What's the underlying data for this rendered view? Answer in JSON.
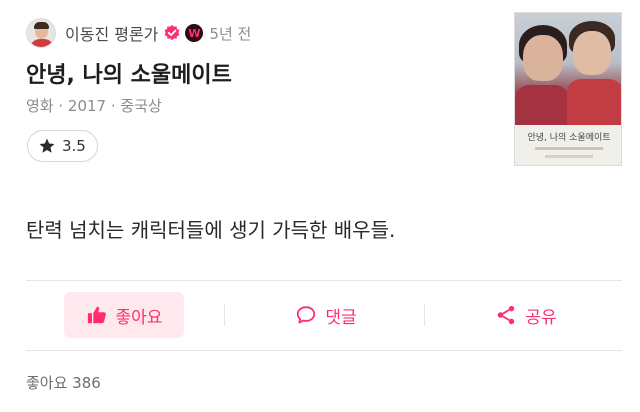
{
  "header": {
    "username": "이동진 평론가",
    "verified_icon": "verified-check-icon",
    "badge_label": "W",
    "time": "5년 전"
  },
  "movie": {
    "title": "안녕, 나의 소울메이트",
    "meta": "영화 · 2017 · 중국상",
    "poster_title": "안녕, 나의 소울메이트"
  },
  "rating": {
    "icon": "star-icon",
    "value": "3.5"
  },
  "comment": {
    "text": "탄력 넘치는 캐릭터들에 생기 가득한 배우들."
  },
  "actions": {
    "like_label": "좋아요",
    "comment_label": "댓글",
    "share_label": "공유"
  },
  "footer": {
    "likes_text": "좋아요 386"
  },
  "colors": {
    "accent": "#ff2f6e",
    "like_bg": "#ffe9ef",
    "text": "#1f1f1f",
    "muted": "#8c8c8c"
  }
}
